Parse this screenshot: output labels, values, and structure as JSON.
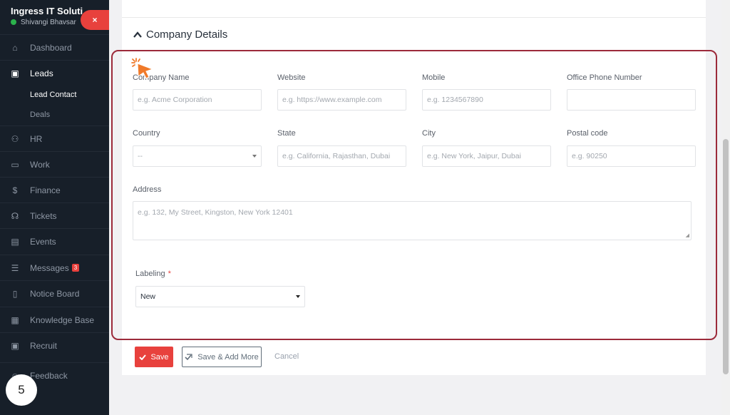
{
  "sidebar": {
    "company_name": "Ingress IT Soluti...",
    "user_name": "Shivangi Bhavsar",
    "close_label": "×",
    "items": [
      {
        "label": "Dashboard",
        "icon": "home-icon"
      },
      {
        "label": "Leads",
        "icon": "leads-icon"
      },
      {
        "label": "HR",
        "icon": "users-icon"
      },
      {
        "label": "Work",
        "icon": "briefcase-icon"
      },
      {
        "label": "Finance",
        "icon": "dollar-icon"
      },
      {
        "label": "Tickets",
        "icon": "headset-icon"
      },
      {
        "label": "Events",
        "icon": "calendar-icon"
      },
      {
        "label": "Messages",
        "icon": "message-icon",
        "badge": "3"
      },
      {
        "label": "Notice Board",
        "icon": "clipboard-icon"
      },
      {
        "label": "Knowledge Base",
        "icon": "document-icon"
      },
      {
        "label": "Recruit",
        "icon": "badge-icon"
      },
      {
        "label": "Feedback",
        "icon": "feedback-icon"
      }
    ],
    "sub_items": [
      {
        "label": "Lead Contact"
      },
      {
        "label": "Deals"
      }
    ]
  },
  "step_number": "5",
  "section": {
    "title": "Company Details"
  },
  "fields": {
    "company_name": {
      "label": "Company Name",
      "placeholder": "e.g. Acme Corporation"
    },
    "website": {
      "label": "Website",
      "placeholder": "e.g. https://www.example.com"
    },
    "mobile": {
      "label": "Mobile",
      "placeholder": "e.g. 1234567890"
    },
    "office_phone": {
      "label": "Office Phone Number",
      "placeholder": ""
    },
    "country": {
      "label": "Country",
      "value": "--"
    },
    "state": {
      "label": "State",
      "placeholder": "e.g. California, Rajasthan, Dubai"
    },
    "city": {
      "label": "City",
      "placeholder": "e.g. New York, Jaipur, Dubai"
    },
    "postal_code": {
      "label": "Postal code",
      "placeholder": "e.g. 90250"
    },
    "address": {
      "label": "Address",
      "placeholder": "e.g. 132, My Street, Kingston, New York 12401"
    },
    "labeling": {
      "label": "Labeling",
      "required_mark": "*",
      "value": "New"
    }
  },
  "actions": {
    "save": "Save",
    "save_add_more": "Save & Add More",
    "cancel": "Cancel"
  },
  "colors": {
    "accent": "#e8413d",
    "sidebar_bg": "#171f29",
    "highlight_border": "#9c2a3a"
  }
}
